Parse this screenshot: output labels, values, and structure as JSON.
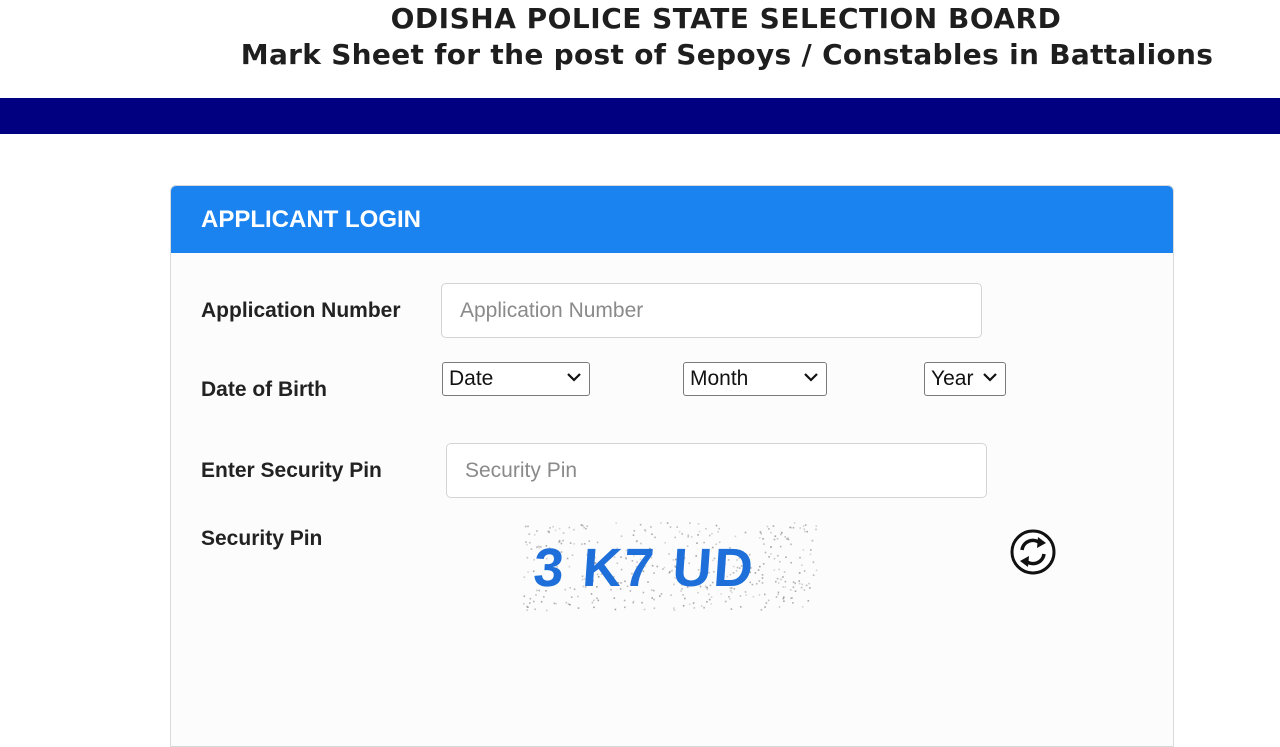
{
  "header": {
    "title": "ODISHA POLICE STATE SELECTION BOARD",
    "subtitle": "Mark Sheet for the post of Sepoys / Constables in Battalions"
  },
  "login": {
    "title": "APPLICANT LOGIN",
    "application_number_label": "Application Number",
    "application_number_placeholder": "Application Number",
    "application_number_value": "",
    "dob_label": "Date of Birth",
    "date_selected": "Date",
    "month_selected": "Month",
    "year_selected": "Year",
    "security_pin_input_label": "Enter Security Pin",
    "security_pin_placeholder": "Security Pin",
    "security_pin_value": "",
    "security_pin_label": "Security Pin",
    "captcha_text": "3 K7 UD",
    "refresh_icon": "refresh-icon"
  },
  "colors": {
    "header_bar": "#000080",
    "card_header": "#1a83f0",
    "captcha_text": "#1e6fd9"
  }
}
